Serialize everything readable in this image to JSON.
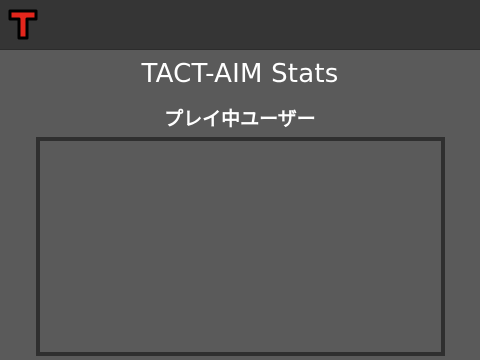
{
  "header": {
    "logo_icon": "t-logo-icon",
    "logo_letter": "T",
    "logo_colors": {
      "fill": "#e3261c",
      "outline": "#000000"
    }
  },
  "main": {
    "title": "TACT-AIM Stats",
    "section_title": "プレイ中ユーザー",
    "users": []
  },
  "colors": {
    "background": "#5a5a5a",
    "topbar": "#353535",
    "panel_border": "#2f2f2f",
    "text": "#ffffff"
  }
}
